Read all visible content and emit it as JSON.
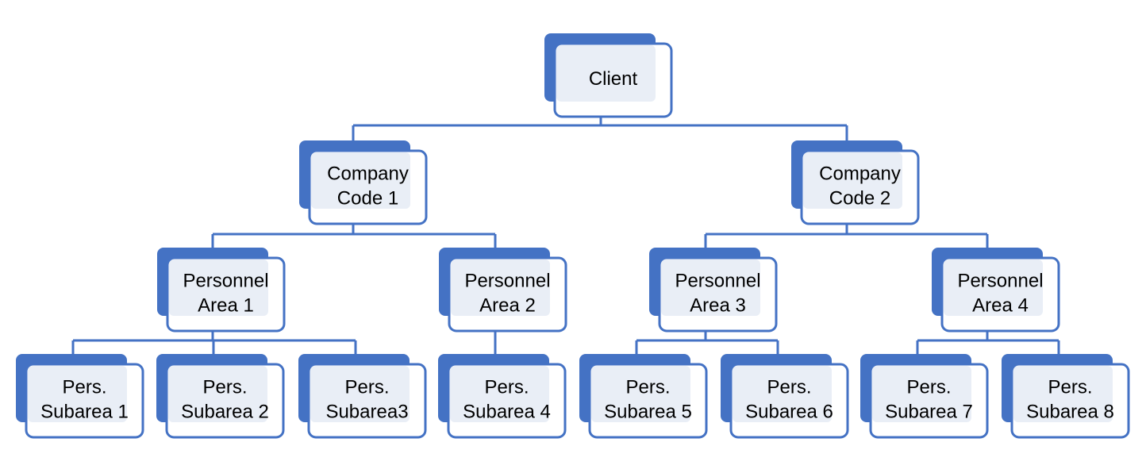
{
  "colors": {
    "accent": "#4472C4",
    "node_fill": "#E9EEF6",
    "background": "#FFFFFF"
  },
  "nodes": [
    {
      "id": "client",
      "lines": [
        "Client"
      ],
      "parent": null
    },
    {
      "id": "cc1",
      "lines": [
        "Company",
        "Code 1"
      ],
      "parent": "client"
    },
    {
      "id": "cc2",
      "lines": [
        "Company",
        "Code 2"
      ],
      "parent": "client"
    },
    {
      "id": "pa1",
      "lines": [
        "Personnel",
        "Area 1"
      ],
      "parent": "cc1"
    },
    {
      "id": "pa2",
      "lines": [
        "Personnel",
        "Area 2"
      ],
      "parent": "cc1"
    },
    {
      "id": "pa3",
      "lines": [
        "Personnel",
        "Area 3"
      ],
      "parent": "cc2"
    },
    {
      "id": "pa4",
      "lines": [
        "Personnel",
        "Area 4"
      ],
      "parent": "cc2"
    },
    {
      "id": "ps1",
      "lines": [
        "Pers.",
        "Subarea 1"
      ],
      "parent": "pa1"
    },
    {
      "id": "ps2",
      "lines": [
        "Pers.",
        "Subarea 2"
      ],
      "parent": "pa1"
    },
    {
      "id": "ps3",
      "lines": [
        "Pers.",
        "Subarea3"
      ],
      "parent": "pa1"
    },
    {
      "id": "ps4",
      "lines": [
        "Pers.",
        "Subarea 4"
      ],
      "parent": "pa2"
    },
    {
      "id": "ps5",
      "lines": [
        "Pers.",
        "Subarea 5"
      ],
      "parent": "pa3"
    },
    {
      "id": "ps6",
      "lines": [
        "Pers.",
        "Subarea 6"
      ],
      "parent": "pa3"
    },
    {
      "id": "ps7",
      "lines": [
        "Pers.",
        "Subarea 7"
      ],
      "parent": "pa4"
    },
    {
      "id": "ps8",
      "lines": [
        "Pers.",
        "Subarea 8"
      ],
      "parent": "pa4"
    }
  ]
}
